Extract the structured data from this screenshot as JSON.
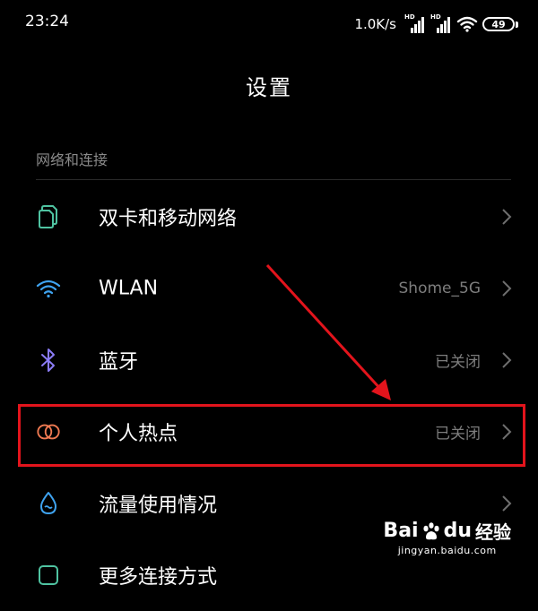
{
  "status_bar": {
    "time": "23:24",
    "net_speed": "1.0K/s",
    "signal_badge": "HD",
    "battery_level": "49"
  },
  "title": "设置",
  "section": {
    "header": "网络和连接"
  },
  "items": [
    {
      "label": "双卡和移动网络",
      "value": "",
      "icon": "sim-card-icon",
      "icon_color": "#4fc3a1"
    },
    {
      "label": "WLAN",
      "value": "Shome_5G",
      "icon": "wifi-icon",
      "icon_color": "#3fa3f0"
    },
    {
      "label": "蓝牙",
      "value": "已关闭",
      "icon": "bluetooth-icon",
      "icon_color": "#8b7cf6"
    },
    {
      "label": "个人热点",
      "value": "已关闭",
      "icon": "hotspot-icon",
      "icon_color": "#f07a52"
    },
    {
      "label": "流量使用情况",
      "value": "",
      "icon": "water-drop-icon",
      "icon_color": "#3fa3f0"
    },
    {
      "label": "更多连接方式",
      "value": "",
      "icon": "more-connections-icon",
      "icon_color": "#4fc3a1"
    }
  ],
  "annotation": {
    "color": "#e3141c"
  },
  "watermark": {
    "brand_a": "Bai",
    "brand_b": "du",
    "product": "经验",
    "url": "jingyan.baidu.com"
  }
}
